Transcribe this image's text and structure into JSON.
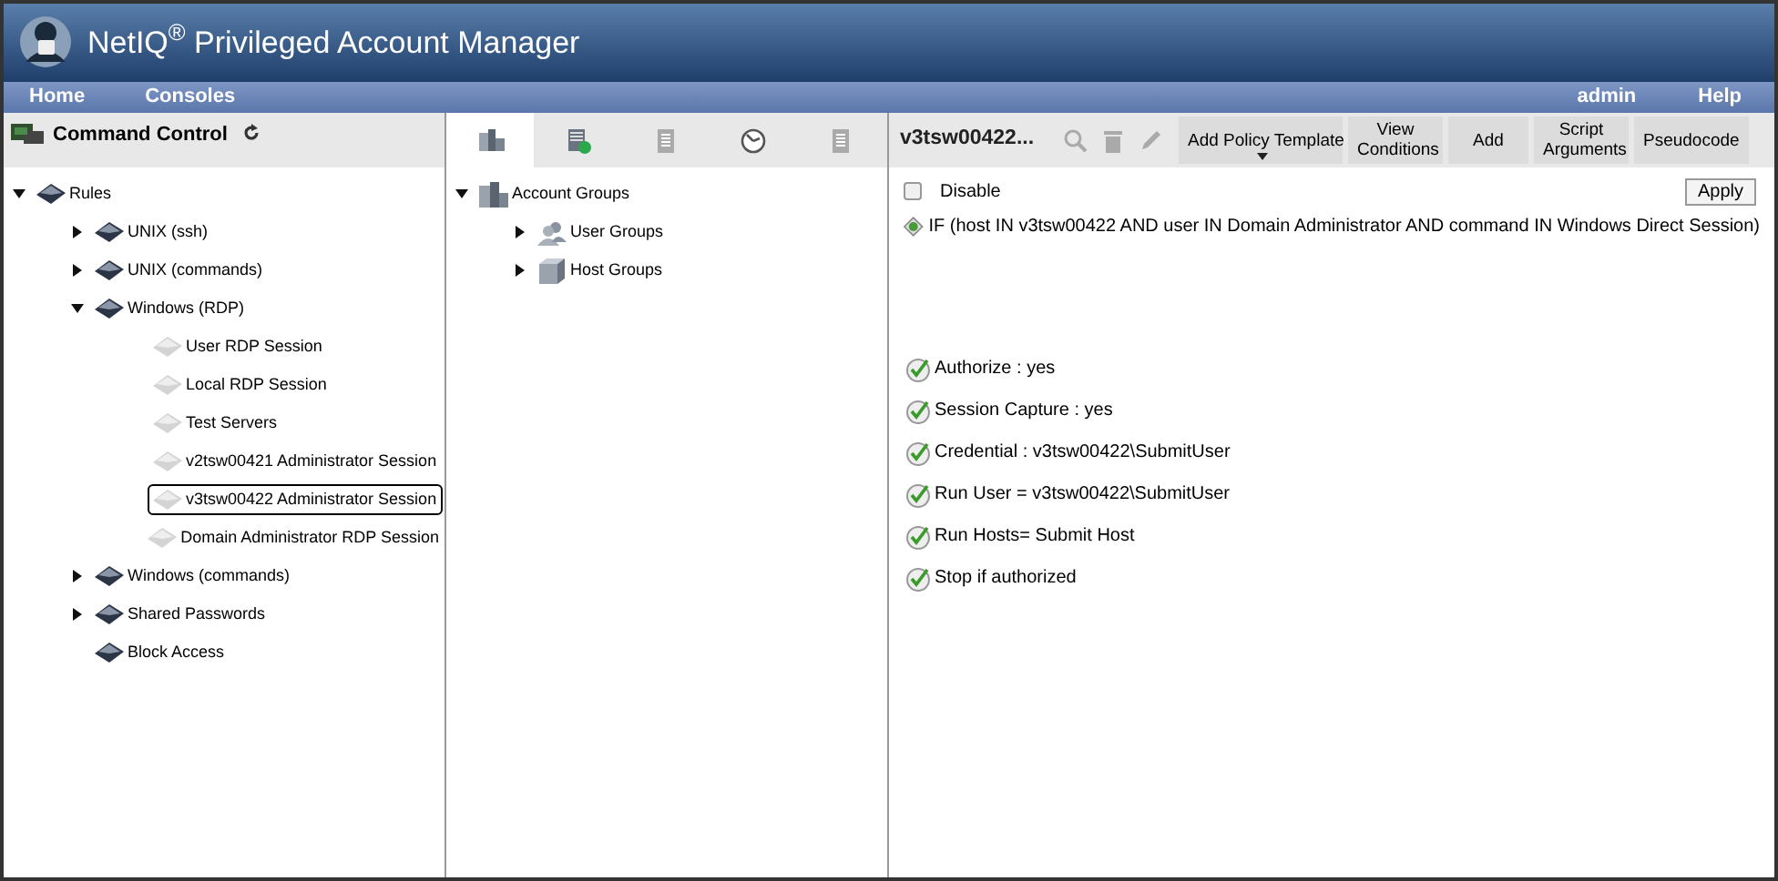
{
  "app": {
    "title": "NetIQ$^{®}$ Privileged Account Manager"
  },
  "menu": {
    "left": [
      "Home",
      "Consoles"
    ],
    "right": [
      "admin",
      "Help"
    ]
  },
  "left_panel": {
    "title": "Command Control",
    "tree": [
      {
        "label": "Rules",
        "kind": "group",
        "expanded": true,
        "selected": false,
        "children": [
          {
            "label": "UNIX (ssh)",
            "kind": "group",
            "expanded": false,
            "selected": false
          },
          {
            "label": "UNIX (commands)",
            "kind": "group",
            "expanded": false,
            "selected": false
          },
          {
            "label": "Windows (RDP)",
            "kind": "group",
            "expanded": true,
            "selected": false,
            "children": [
              {
                "label": "User RDP Session",
                "kind": "rule",
                "selected": false
              },
              {
                "label": "Local RDP Session",
                "kind": "rule",
                "selected": false
              },
              {
                "label": "Test Servers",
                "kind": "rule",
                "selected": false
              },
              {
                "label": "v2tsw00421 Administrator Session",
                "kind": "rule",
                "selected": false
              },
              {
                "label": "v3tsw00422 Administrator Session",
                "kind": "rule",
                "selected": true
              },
              {
                "label": "Domain Administrator RDP Session",
                "kind": "rule",
                "selected": false
              }
            ]
          },
          {
            "label": "Windows (commands)",
            "kind": "group",
            "expanded": false,
            "selected": false
          },
          {
            "label": "Shared Passwords",
            "kind": "group",
            "expanded": false,
            "selected": false
          },
          {
            "label": "Block Access",
            "kind": "group",
            "selected": false
          }
        ]
      }
    ]
  },
  "middle_panel": {
    "tabs": [
      {
        "kind": "accounts",
        "selected": true
      },
      {
        "kind": "scripts",
        "selected": false
      },
      {
        "kind": "commands",
        "selected": false
      },
      {
        "kind": "schedules",
        "selected": false
      },
      {
        "kind": "files",
        "selected": false
      }
    ],
    "tree": [
      {
        "label": "Account Groups",
        "kind": "accounts",
        "expanded": true,
        "children": [
          {
            "label": "User Groups",
            "kind": "users",
            "expanded": false
          },
          {
            "label": "Host Groups",
            "kind": "hosts",
            "expanded": false
          }
        ]
      }
    ]
  },
  "right_panel": {
    "title": "v3tsw00422...",
    "buttons": [
      "Add Policy Template",
      "View Conditions",
      "Add",
      "Script Arguments",
      "Pseudocode"
    ],
    "disable": {
      "label": "Disable",
      "checked": false
    },
    "apply": "Apply",
    "condition": "IF (host IN v3tsw00422 AND user IN Domain Administrator AND command IN Windows Direct Session)",
    "actions": [
      "Authorize : yes",
      "Session Capture : yes",
      "Credential : v3tsw00422\\SubmitUser",
      "Run User = v3tsw00422\\SubmitUser",
      "Run Hosts= Submit Host",
      "Stop if authorized"
    ]
  }
}
